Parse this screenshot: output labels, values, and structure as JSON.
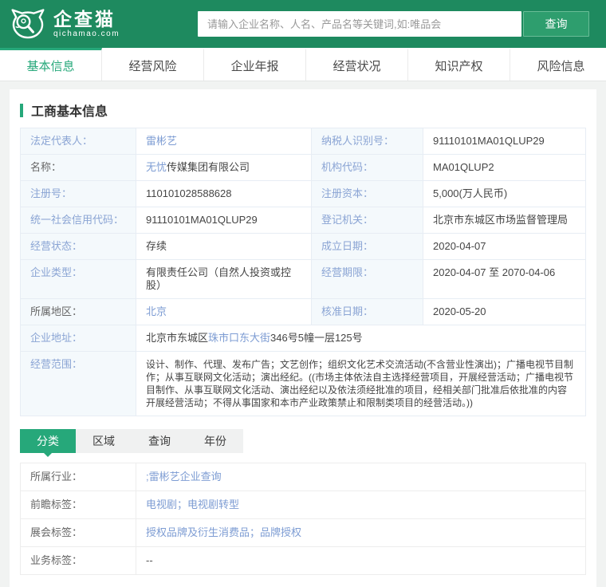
{
  "header": {
    "brand": {
      "name": "企查猫",
      "domain": "qichamao.com",
      "icon": "cat-magnifier-icon"
    },
    "search": {
      "placeholder": "请输入企业名称、人名、产品名等关键词,如:唯品会",
      "value": "",
      "button_label": "查询"
    }
  },
  "nav": {
    "tabs": [
      {
        "id": "basic-info",
        "label": "基本信息",
        "active": true
      },
      {
        "id": "business-risk",
        "label": "经营风险",
        "active": false
      },
      {
        "id": "annual-report",
        "label": "企业年报",
        "active": false
      },
      {
        "id": "business-status",
        "label": "经营状况",
        "active": false
      },
      {
        "id": "intellectual-property",
        "label": "知识产权",
        "active": false
      },
      {
        "id": "risk-info",
        "label": "风险信息",
        "active": false
      }
    ]
  },
  "section": {
    "title": "工商基本信息"
  },
  "info_table": {
    "rows": [
      {
        "cells": [
          {
            "label": "法定代表人：",
            "label_link": true,
            "value": [
              {
                "text": "雷彬艺",
                "link": true
              }
            ]
          },
          {
            "label": "纳税人识别号：",
            "label_link": true,
            "value": [
              {
                "text": "91110101MA01QLUP29"
              }
            ]
          }
        ]
      },
      {
        "cells": [
          {
            "label": "名称：",
            "label_link": false,
            "value": [
              {
                "text": "无忧",
                "link": true
              },
              {
                "text": "传媒集团有限公司"
              }
            ]
          },
          {
            "label": "机构代码：",
            "label_link": true,
            "value": [
              {
                "text": "MA01QLUP2"
              }
            ]
          }
        ]
      },
      {
        "cells": [
          {
            "label": "注册号：",
            "label_link": true,
            "value": [
              {
                "text": "110101028588628"
              }
            ]
          },
          {
            "label": "注册资本：",
            "label_link": true,
            "value": [
              {
                "text": "5,000(万人民币)"
              }
            ]
          }
        ]
      },
      {
        "cells": [
          {
            "label": "统一社会信用代码：",
            "label_link": true,
            "value": [
              {
                "text": "91110101MA01QLUP29"
              }
            ]
          },
          {
            "label": "登记机关：",
            "label_link": true,
            "value": [
              {
                "text": "北京市东城区市场监督管理局"
              }
            ]
          }
        ]
      },
      {
        "cells": [
          {
            "label": "经营状态：",
            "label_link": true,
            "value": [
              {
                "text": "存续"
              }
            ]
          },
          {
            "label": "成立日期：",
            "label_link": true,
            "value": [
              {
                "text": "2020-04-07"
              }
            ]
          }
        ]
      },
      {
        "cells": [
          {
            "label": "企业类型：",
            "label_link": true,
            "value": [
              {
                "text": "有限责任公司（自然人投资或控股）"
              }
            ]
          },
          {
            "label": "经营期限：",
            "label_link": true,
            "value": [
              {
                "text": "2020-04-07 至 2070-04-06"
              }
            ]
          }
        ]
      },
      {
        "cells": [
          {
            "label": "所属地区：",
            "label_link": false,
            "value": [
              {
                "text": "北京",
                "link": true
              }
            ]
          },
          {
            "label": "核准日期：",
            "label_link": true,
            "value": [
              {
                "text": "2020-05-20"
              }
            ]
          }
        ]
      },
      {
        "cells": [
          {
            "label": "企业地址：",
            "label_link": true,
            "span": true,
            "value": [
              {
                "text": "北京市东城区"
              },
              {
                "text": "珠市口东大街",
                "link": true
              },
              {
                "text": "346号5幢一层125号"
              }
            ]
          }
        ]
      },
      {
        "cells": [
          {
            "label": "经营范围：",
            "label_link": true,
            "span": true,
            "scope": true,
            "value": [
              {
                "text": "设计、制作、代理、发布广告；文艺创作；组织文化艺术交流活动(不含营业性演出)；广播电视节目制作；从事互联网文化活动；演出经纪。((市场主体依法自主选择经营项目，开展经营活动；广播电视节目制作、从事互联网文化活动、演出经纪以及依法须经批准的项目，经相关部门批准后依批准的内容开展经营活动；不得从事国家和本市产业政策禁止和限制类项目的经营活动。))"
              }
            ]
          }
        ]
      }
    ]
  },
  "sub_tabs": [
    {
      "id": "category",
      "label": "分类",
      "active": true
    },
    {
      "id": "region",
      "label": "区域",
      "active": false
    },
    {
      "id": "query",
      "label": "查询",
      "active": false
    },
    {
      "id": "year",
      "label": "年份",
      "active": false
    }
  ],
  "tags_table": {
    "rows": [
      {
        "label": "所属行业：",
        "value": [
          {
            "text": ";雷彬艺企业查询",
            "link": true
          }
        ]
      },
      {
        "label": "前瞻标签：",
        "value": [
          {
            "text": "电视剧；电视剧转型",
            "link": true
          }
        ]
      },
      {
        "label": "展会标签：",
        "value": [
          {
            "text": "授权品牌及衍生消费品；品牌授权",
            "link": true
          }
        ]
      },
      {
        "label": "业务标签：",
        "value": [
          {
            "text": "--"
          }
        ]
      }
    ]
  },
  "colors": {
    "header_green": "#1E8A5F",
    "accent_green": "#26A87A",
    "link_blue": "#7D9CD3",
    "label_blue": "#8AA4D4"
  }
}
